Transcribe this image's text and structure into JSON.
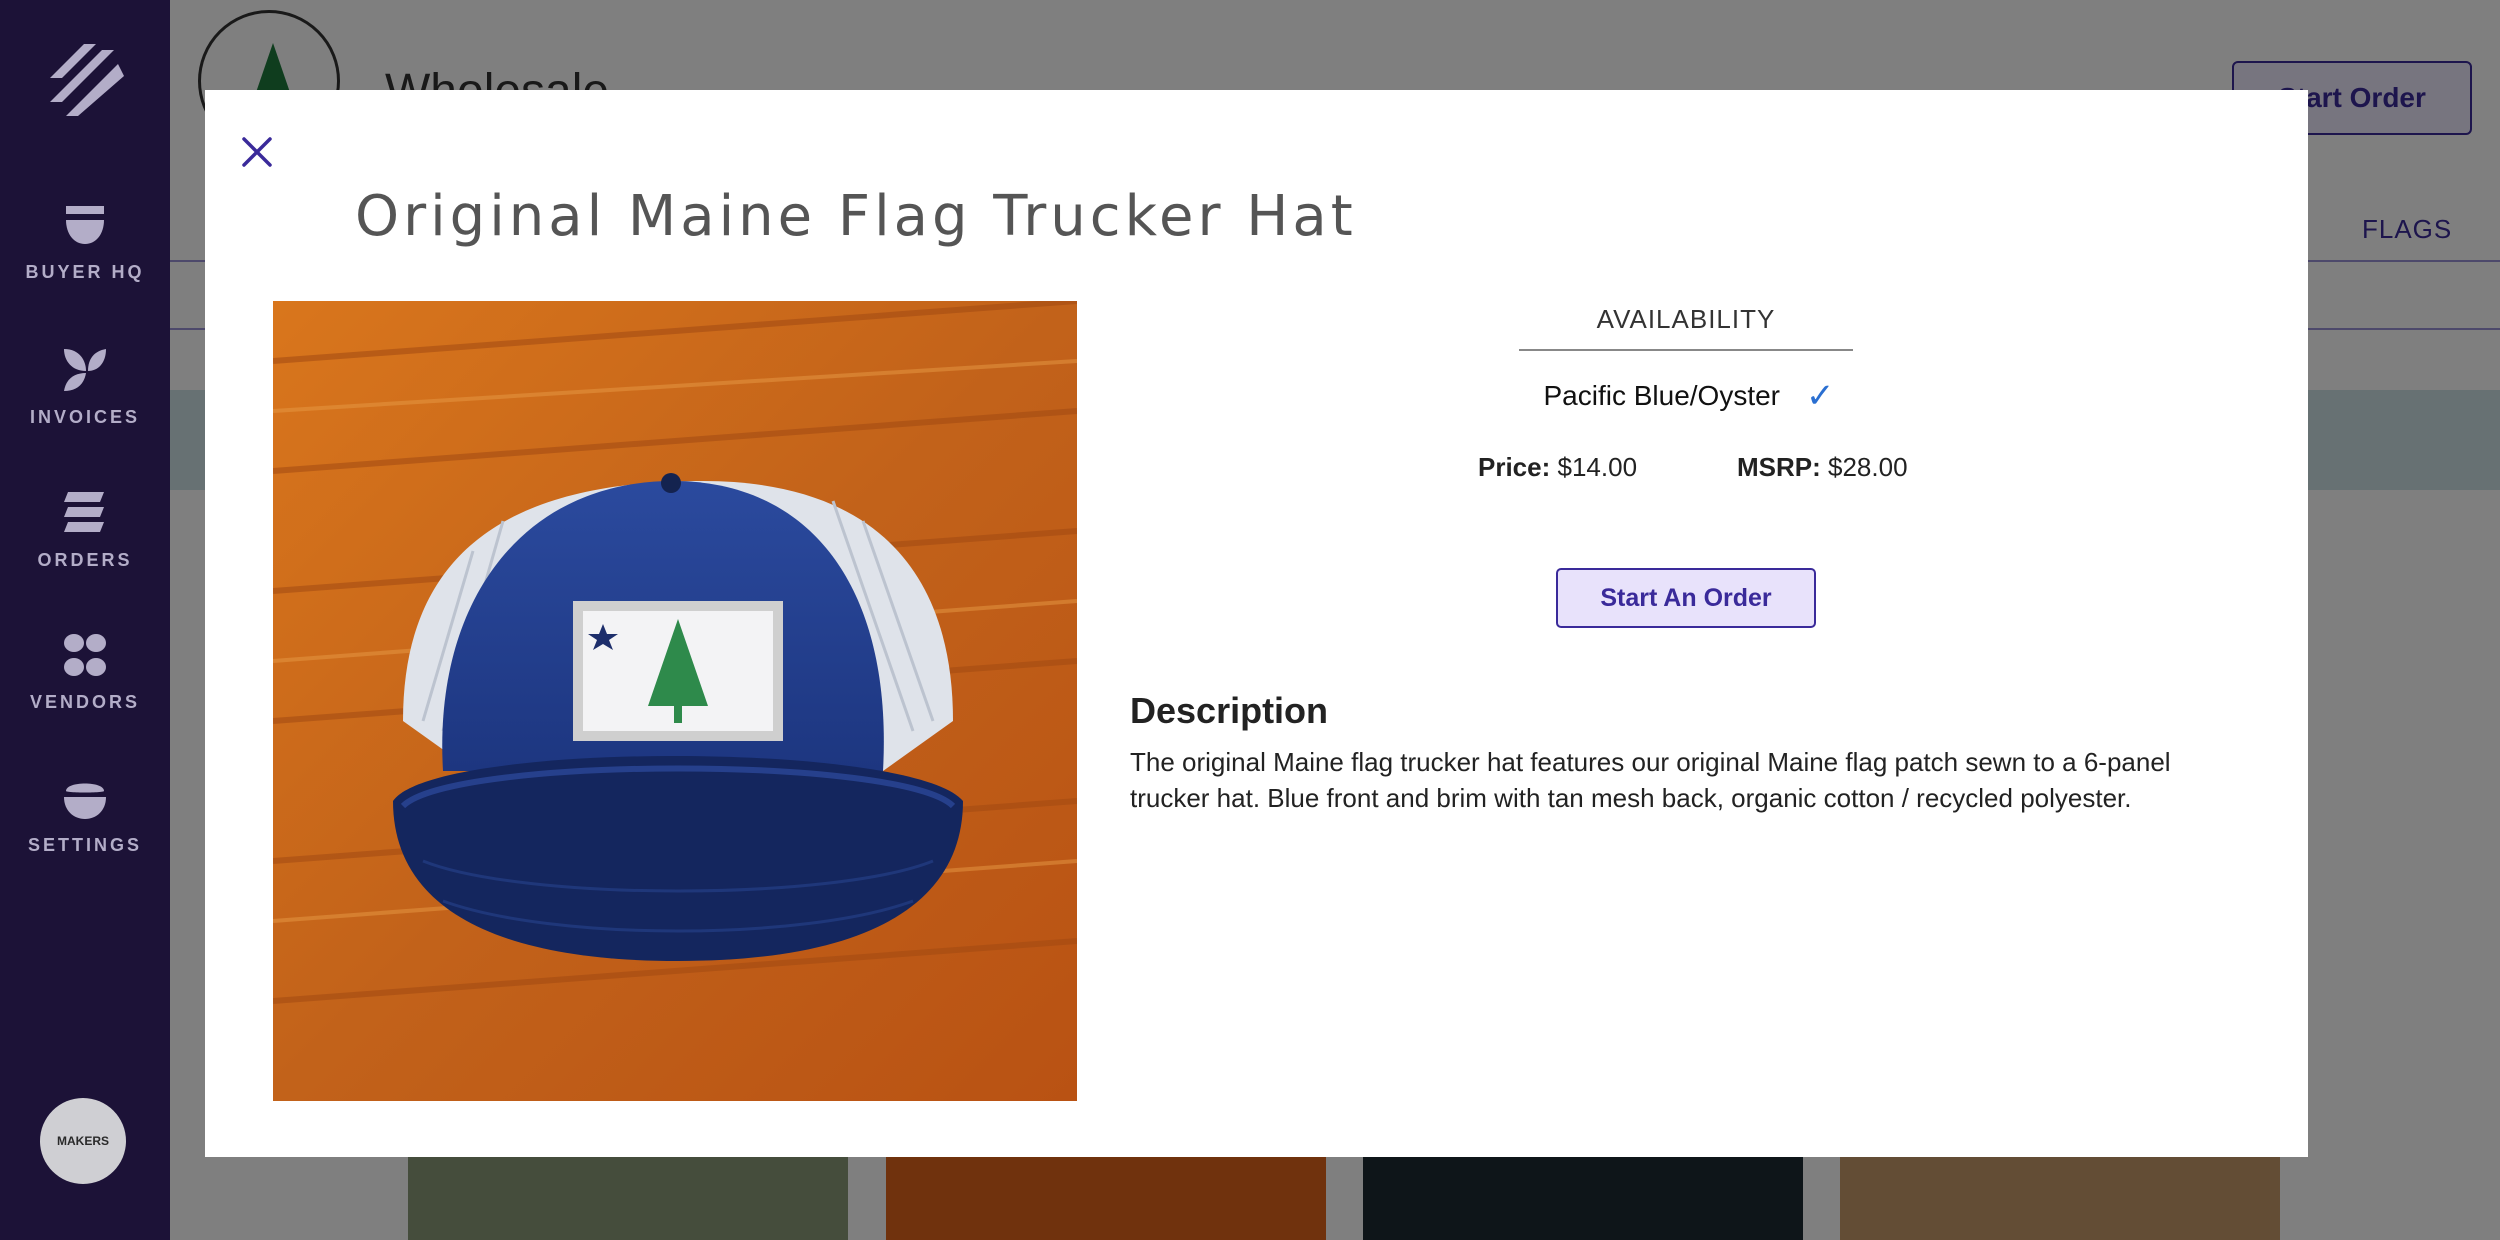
{
  "sidebar": {
    "items": [
      {
        "label": "BUYER HQ",
        "icon": "bowl-icon"
      },
      {
        "label": "INVOICES",
        "icon": "leaf-icon"
      },
      {
        "label": "ORDERS",
        "icon": "stack-icon"
      },
      {
        "label": "VENDORS",
        "icon": "petals-icon"
      },
      {
        "label": "SETTINGS",
        "icon": "smile-icon"
      }
    ],
    "makers_badge": "MAKERS"
  },
  "background": {
    "page_title": "Wholesale",
    "start_order_label": "Start Order",
    "flags_tab": "FLAGS"
  },
  "modal": {
    "title": "Original Maine Flag Trucker Hat",
    "availability_label": "AVAILABILITY",
    "variant": "Pacific Blue/Oyster",
    "variant_check": "✓",
    "price_label": "Price:",
    "price_value": "$14.00",
    "msrp_label": "MSRP:",
    "msrp_value": "$28.00",
    "start_order_button": "Start An Order",
    "description_heading": "Description",
    "description_text": "The original Maine flag trucker hat features our original Maine flag patch sewn to a 6-panel trucker hat. Blue front and brim with tan mesh back, organic cotton / recycled polyester."
  },
  "colors": {
    "sidebar_bg": "#1c1237",
    "accent": "#3a2a9a",
    "check": "#2a6fd1"
  }
}
